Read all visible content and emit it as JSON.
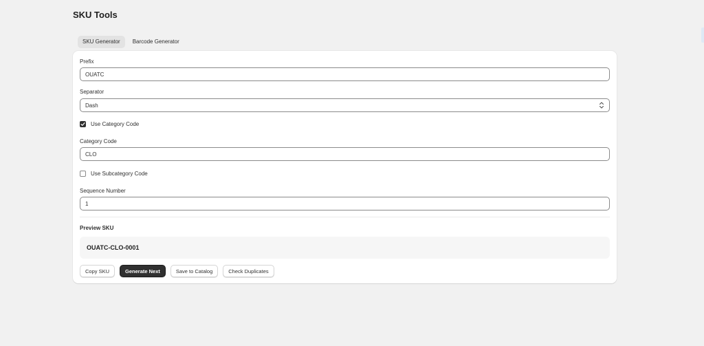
{
  "page": {
    "title": "SKU Tools"
  },
  "tabs": [
    {
      "label": "SKU Generator",
      "active": true
    },
    {
      "label": "Barcode Generator",
      "active": false
    }
  ],
  "form": {
    "prefix_label": "Prefix",
    "prefix_value": "OUATC",
    "separator_label": "Separator",
    "separator_value": "Dash",
    "use_category_label": "Use Category Code",
    "use_category_checked": true,
    "category_code_label": "Category Code",
    "category_code_value": "CLO",
    "use_subcategory_label": "Use Subcategory Code",
    "use_subcategory_checked": false,
    "sequence_label": "Sequence Number",
    "sequence_value": "1"
  },
  "preview": {
    "label": "Preview SKU",
    "value": "OUATC-CLO-0001"
  },
  "actions": {
    "copy": "Copy SKU",
    "generate": "Generate Next",
    "save": "Save to Catalog",
    "check": "Check Duplicates"
  },
  "colors": {
    "primary_button": "#303030",
    "background": "#f1f1f1",
    "card": "#ffffff"
  }
}
